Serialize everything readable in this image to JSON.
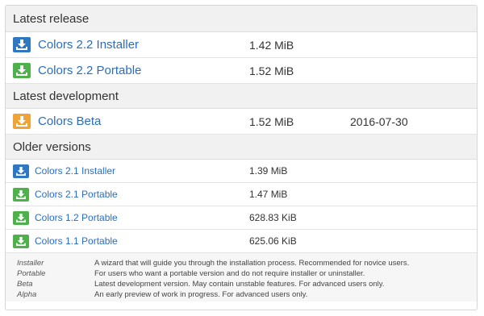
{
  "colors": {
    "blue": "#2f77c0",
    "green": "#4fb14c",
    "orange": "#efa43a",
    "link": "#2a6ebb"
  },
  "sections": {
    "latest_release": {
      "title": "Latest release",
      "rows": [
        {
          "name": "Colors 2.2 Installer",
          "size": "1.42 MiB",
          "icon": "download-icon",
          "color": "blue"
        },
        {
          "name": "Colors 2.2 Portable",
          "size": "1.52 MiB",
          "icon": "download-icon",
          "color": "green"
        }
      ]
    },
    "latest_development": {
      "title": "Latest development",
      "rows": [
        {
          "name": "Colors Beta",
          "size": "1.52 MiB",
          "date": "2016-07-30",
          "icon": "download-icon",
          "color": "orange"
        }
      ]
    },
    "older_versions": {
      "title": "Older versions",
      "rows": [
        {
          "name": "Colors 2.1 Installer",
          "size": "1.39 MiB",
          "icon": "download-icon",
          "color": "blue"
        },
        {
          "name": "Colors 2.1 Portable",
          "size": "1.47 MiB",
          "icon": "download-icon",
          "color": "green"
        },
        {
          "name": "Colors 1.2 Portable",
          "size": "628.83 KiB",
          "icon": "download-icon",
          "color": "green"
        },
        {
          "name": "Colors 1.1 Portable",
          "size": "625.06 KiB",
          "icon": "download-icon",
          "color": "green"
        }
      ]
    }
  },
  "legend": [
    {
      "term": "Installer",
      "desc": "A wizard that will guide you through the installation process. Recommended for novice users."
    },
    {
      "term": "Portable",
      "desc": "For users who want a portable version and do not require installer or uninstaller."
    },
    {
      "term": "Beta",
      "desc": "Latest development version. May contain unstable features. For advanced users only."
    },
    {
      "term": "Alpha",
      "desc": "An early preview of work in progress. For advanced users only."
    }
  ]
}
